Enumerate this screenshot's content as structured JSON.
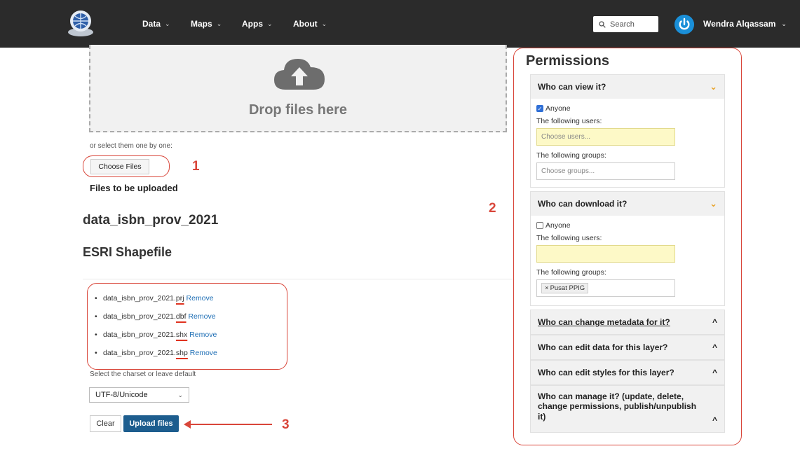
{
  "navbar": {
    "menu": [
      {
        "label": "Data",
        "chevron": "⌄"
      },
      {
        "label": "Maps",
        "chevron": "⌄"
      },
      {
        "label": "Apps",
        "chevron": "⌄"
      },
      {
        "label": "About",
        "chevron": "⌄"
      }
    ],
    "search_placeholder": "Search",
    "username": "Wendra Alqassam",
    "username_chevron": "⌄"
  },
  "upload": {
    "drop_text": "Drop files here",
    "select_hint": "or select them one by one:",
    "choose_files": "Choose Files",
    "files_heading": "Files to be uploaded",
    "dataset_name": "data_isbn_prov_2021",
    "dataset_type": "ESRI Shapefile",
    "files": [
      {
        "base": "data_isbn_prov_2021.",
        "ext": "prj",
        "remove": "Remove"
      },
      {
        "base": "data_isbn_prov_2021.",
        "ext": "dbf",
        "remove": "Remove"
      },
      {
        "base": "data_isbn_prov_2021.",
        "ext": "shx",
        "remove": "Remove"
      },
      {
        "base": "data_isbn_prov_2021.",
        "ext": "shp",
        "remove": "Remove"
      }
    ],
    "charset_label": "Select the charset or leave default",
    "charset_value": "UTF-8/Unicode",
    "clear": "Clear",
    "upload_button": "Upload files"
  },
  "annotations": {
    "one": "1",
    "two": "2",
    "three": "3"
  },
  "permissions": {
    "title": "Permissions",
    "view": {
      "header": "Who can view it?",
      "anyone": "Anyone",
      "anyone_checked": true,
      "users_label": "The following users:",
      "users_placeholder": "Choose users...",
      "groups_label": "The following groups:",
      "groups_placeholder": "Choose groups..."
    },
    "download": {
      "header": "Who can download it?",
      "anyone": "Anyone",
      "anyone_checked": false,
      "users_label": "The following users:",
      "groups_label": "The following groups:",
      "group_tag": "Pusat PPIG",
      "tag_remove": "×"
    },
    "collapsed": [
      {
        "label": "Who can change metadata for it?"
      },
      {
        "label": "Who can edit data for this layer?"
      },
      {
        "label": "Who can edit styles for this layer?"
      },
      {
        "label": "Who can manage it? (update, delete, change permissions, publish/unpublish it)"
      }
    ]
  },
  "colors": {
    "navbar": "#2b2b2b",
    "accent": "#1d5d8e",
    "annotation": "#d9463a",
    "link": "#1f6fb5",
    "chevron_open": "#e8a021"
  }
}
